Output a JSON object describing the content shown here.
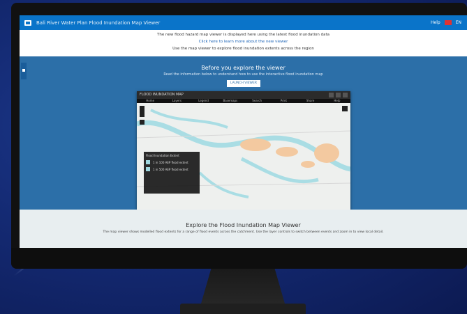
{
  "topbar": {
    "title": "Bali River Water Plan Flood Inundation Map Viewer",
    "right_items": [
      "Help",
      "EN"
    ]
  },
  "notice": {
    "line1": "The new flood hazard map viewer is displayed here using the latest flood inundation data",
    "link": "Click here to learn more about the new viewer",
    "line3": "Use the map viewer to explore flood inundation extents across the region"
  },
  "hero": {
    "title": "Before you explore the viewer",
    "subtitle": "Read the information below to understand how to use the interactive flood inundation map",
    "button": "LAUNCH VIEWER"
  },
  "map_window": {
    "title": "FLOOD INUNDATION MAP",
    "tabs": [
      "Home",
      "Layers",
      "Legend",
      "Basemaps",
      "Search",
      "Print",
      "Share",
      "Help"
    ],
    "legend_title": "Flood Inundation Extent",
    "legend_items": [
      "1 in 100 AEP flood extent",
      "1 in 500 AEP flood extent"
    ]
  },
  "section2": {
    "title": "Explore the Flood Inundation Map Viewer",
    "text": "The map viewer shows modelled flood extents for a range of flood events across the catchment. Use the layer controls to switch between events and zoom in to view local detail."
  },
  "colors": {
    "topbar": "#0a74c9",
    "hero": "#2c6fa8",
    "flood_blue": "#9fd8e0",
    "flood_orange": "#f3c9a0"
  }
}
